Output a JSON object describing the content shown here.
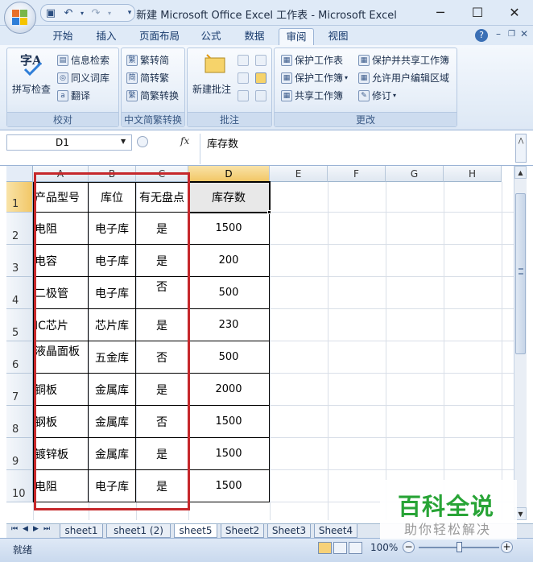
{
  "window": {
    "title": "新建 Microsoft Office Excel 工作表 - Microsoft Excel",
    "minimize": "─",
    "maximize": "☐",
    "close": "✕"
  },
  "ribbon_tabs": [
    "开始",
    "插入",
    "页面布局",
    "公式",
    "数据",
    "审阅",
    "视图"
  ],
  "active_tab": "审阅",
  "ribbon": {
    "proofing": {
      "label": "校对",
      "spell_check": "拼写检查",
      "research": "信息检索",
      "thesaurus": "同义词库",
      "translate": "翻译"
    },
    "chinese_conversion": {
      "label": "中文简繁转换",
      "to_traditional": "繁转简",
      "to_simplified": "简转繁",
      "convert": "简繁转换"
    },
    "comments": {
      "label": "批注",
      "new_comment": "新建批注"
    },
    "changes": {
      "label": "更改",
      "protect_sheet": "保护工作表",
      "protect_workbook": "保护工作簿",
      "share_workbook": "共享工作簿",
      "protect_share": "保护并共享工作簿",
      "allow_edit_ranges": "允许用户编辑区域",
      "track_changes": "修订"
    }
  },
  "formula_bar": {
    "name_box": "D1",
    "fx": "fx",
    "content": "库存数"
  },
  "columns": [
    "A",
    "B",
    "C",
    "D",
    "E",
    "F",
    "G",
    "H"
  ],
  "rows": [
    "1",
    "2",
    "3",
    "4",
    "5",
    "6",
    "7",
    "8",
    "9",
    "10"
  ],
  "table": {
    "headers": [
      "产品型号",
      "库位",
      "有无盘点",
      "库存数"
    ],
    "data": [
      [
        "电阻",
        "电子库",
        "是",
        "1500"
      ],
      [
        "电容",
        "电子库",
        "是",
        "200"
      ],
      [
        "二极管",
        "电子库",
        "否",
        "500"
      ],
      [
        "IC芯片",
        "芯片库",
        "是",
        "230"
      ],
      [
        "液晶面板",
        "五金库",
        "否",
        "500"
      ],
      [
        "铜板",
        "金属库",
        "是",
        "2000"
      ],
      [
        "钢板",
        "金属库",
        "否",
        "1500"
      ],
      [
        "镀锌板",
        "金属库",
        "是",
        "1500"
      ],
      [
        "电阻",
        "电子库",
        "是",
        "1500"
      ]
    ]
  },
  "sheet_tabs": [
    "sheet1",
    "sheet1 (2)",
    "sheet5",
    "Sheet2",
    "Sheet3",
    "Sheet4"
  ],
  "active_sheet": "sheet5",
  "status": {
    "mode": "就绪",
    "zoom": "100%",
    "zoom_minus": "−",
    "zoom_plus": "+"
  },
  "watermark": {
    "main": "百科全说",
    "sub": "助你轻松解决"
  },
  "colors": {
    "selection_frame": "#c6282b",
    "watermark_green": "#28a436"
  }
}
